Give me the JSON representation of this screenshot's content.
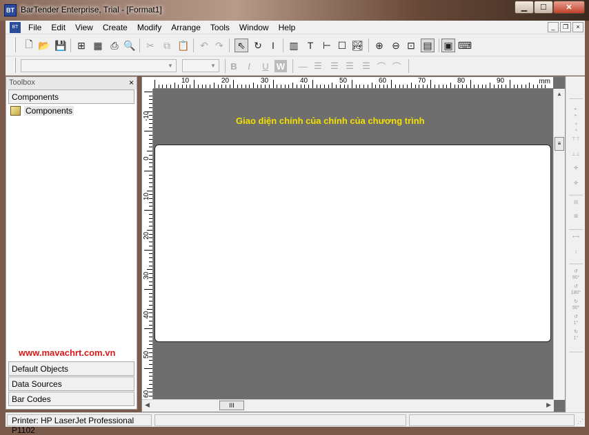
{
  "window": {
    "title": "BarTender Enterprise, Trial - [Format1]",
    "app_icon_text": "BT",
    "minimize": "▁",
    "maximize": "☐",
    "close": "✕"
  },
  "menu": {
    "items": [
      "File",
      "Edit",
      "View",
      "Create",
      "Modify",
      "Arrange",
      "Tools",
      "Window",
      "Help"
    ],
    "mdi_minimize": "_",
    "mdi_restore": "❐",
    "mdi_close": "×"
  },
  "toolbar": {
    "icons": [
      "new-icon",
      "open-icon",
      "save-icon",
      "page-setup-icon",
      "database-icon",
      "print-icon",
      "print-preview-icon",
      "cut-icon",
      "copy-icon",
      "paste-icon",
      "undo-icon",
      "redo-icon",
      "select-icon",
      "rotate-icon",
      "text-cursor-icon",
      "barcode-icon",
      "text-icon",
      "line-icon",
      "rectangle-icon",
      "picture-icon",
      "zoom-in-icon",
      "zoom-out-icon",
      "zoom-fit-icon",
      "zoom-page-icon",
      "screen-view-icon",
      "keyboard-icon"
    ]
  },
  "format_toolbar": {
    "font_name": "",
    "font_size": "",
    "bold": "B",
    "italic": "I",
    "underline": "U",
    "reverse": "W"
  },
  "toolbox": {
    "title": "Toolbox",
    "close": "×",
    "components_header": "Components",
    "tree_item": "Components",
    "sections": [
      "Default Objects",
      "Data Sources",
      "Bar Codes"
    ],
    "watermark": "www.mavachrt.com.vn"
  },
  "ruler": {
    "unit": "mm",
    "h_labels": [
      "10",
      "20",
      "30",
      "40",
      "50",
      "60",
      "70",
      "80",
      "90"
    ],
    "v_labels": [
      "-10",
      "0",
      "10",
      "20",
      "30",
      "40",
      "50",
      "60"
    ]
  },
  "canvas": {
    "caption": "Giao diện chính của chính của chương trình"
  },
  "scroll": {
    "thumb_grip": "III",
    "vthumb_grip": "≡"
  },
  "status": {
    "printer": "Printer: HP LaserJet Professional P1102"
  }
}
